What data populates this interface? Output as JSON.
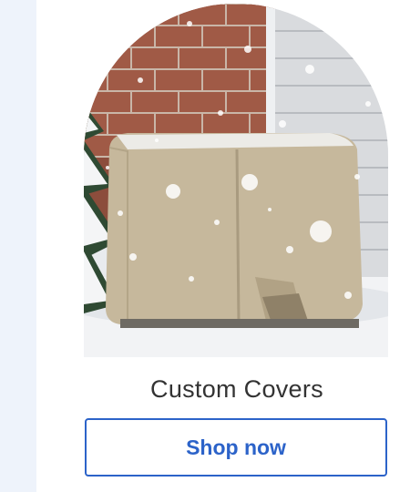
{
  "product": {
    "title": "Custom Covers",
    "button_label": "Shop now",
    "image_description": "snow-covered AC unit cover"
  },
  "colors": {
    "left_strip": "#eef3fb",
    "accent": "#2c63c9",
    "title_text": "#333333"
  }
}
